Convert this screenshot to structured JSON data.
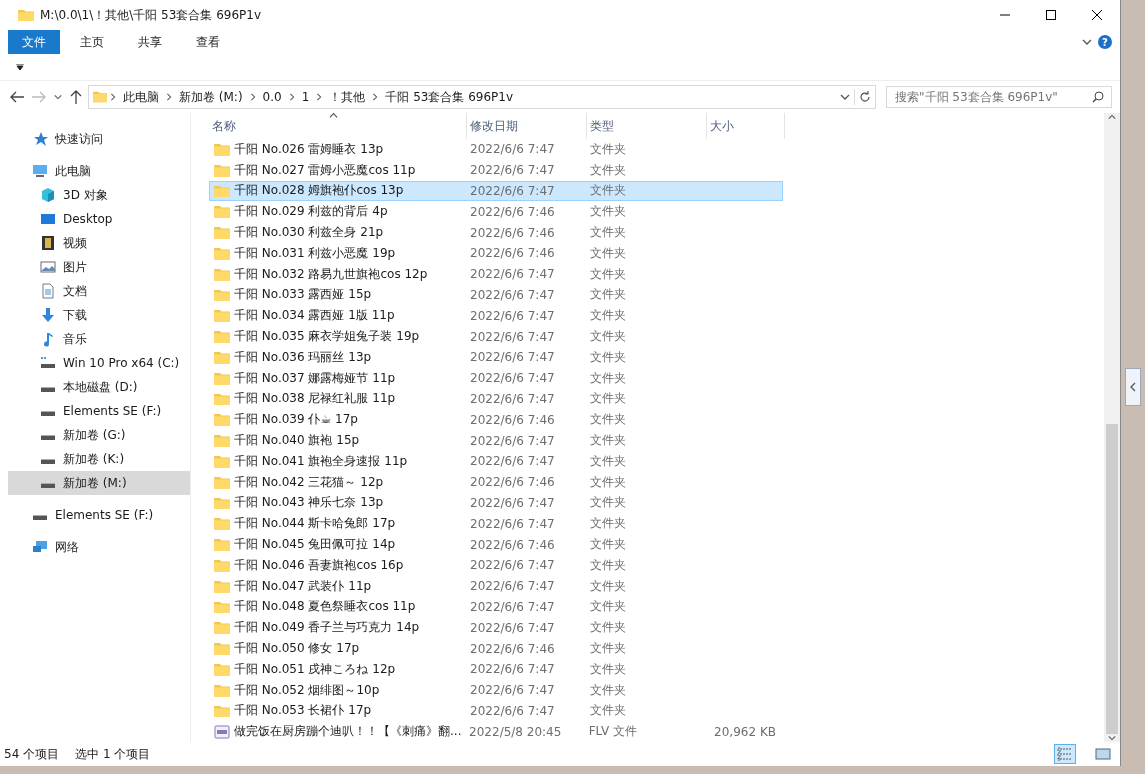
{
  "window": {
    "title": "M:\\0.0\\1\\！其他\\千阳 53套合集 696P1v"
  },
  "ribbon": {
    "tabs": [
      {
        "label": "文件",
        "selected": true
      },
      {
        "label": "主页",
        "selected": false
      },
      {
        "label": "共享",
        "selected": false
      },
      {
        "label": "查看",
        "selected": false
      }
    ],
    "help": "?"
  },
  "address_bar": {
    "path": [
      "此电脑",
      "新加卷 (M:)",
      "0.0",
      "1",
      "！其他",
      "千阳 53套合集 696P1v"
    ]
  },
  "search": {
    "placeholder": "搜索\"千阳 53套合集 696P1v\""
  },
  "sidebar": {
    "items": [
      {
        "label": "快速访问",
        "kind": "star",
        "selected": false
      },
      {
        "label": "此电脑",
        "kind": "pc",
        "selected": false,
        "children": [
          {
            "label": "3D 对象",
            "kind": "cube",
            "selected": false
          },
          {
            "label": "Desktop",
            "kind": "desktop",
            "selected": false
          },
          {
            "label": "视频",
            "kind": "film",
            "selected": false
          },
          {
            "label": "图片",
            "kind": "picture",
            "selected": false
          },
          {
            "label": "文档",
            "kind": "document",
            "selected": false
          },
          {
            "label": "下载",
            "kind": "download",
            "selected": false
          },
          {
            "label": "音乐",
            "kind": "music",
            "selected": false
          },
          {
            "label": "Win 10 Pro x64 (C:)",
            "kind": "system-drive",
            "selected": false
          },
          {
            "label": "本地磁盘 (D:)",
            "kind": "drive",
            "selected": false
          },
          {
            "label": "Elements SE (F:)",
            "kind": "drive",
            "selected": false
          },
          {
            "label": "新加卷 (G:)",
            "kind": "drive",
            "selected": false
          },
          {
            "label": "新加卷 (K:)",
            "kind": "drive",
            "selected": false
          },
          {
            "label": "新加卷 (M:)",
            "kind": "drive",
            "selected": true
          }
        ]
      },
      {
        "label": "Elements SE (F:)",
        "kind": "drive",
        "selected": false
      },
      {
        "label": "网络",
        "kind": "network",
        "selected": false
      }
    ]
  },
  "table": {
    "columns": [
      "名称",
      "修改日期",
      "类型",
      "大小"
    ],
    "rows": [
      {
        "kind": "folder",
        "name": "千阳 No.026 雷姆睡衣 13p",
        "date": "2022/6/6 7:47",
        "type": "文件夹",
        "selected": false
      },
      {
        "kind": "folder",
        "name": "千阳 No.027 雷姆小恶魔cos 11p",
        "date": "2022/6/6 7:47",
        "type": "文件夹",
        "selected": false
      },
      {
        "kind": "folder",
        "name": "千阳 No.028 姆旗袍仆cos 13p",
        "date": "2022/6/6 7:47",
        "type": "文件夹",
        "selected": true
      },
      {
        "kind": "folder",
        "name": "千阳 No.029 利兹的背后 4p",
        "date": "2022/6/6 7:46",
        "type": "文件夹",
        "selected": false
      },
      {
        "kind": "folder",
        "name": "千阳 No.030 利兹全身 21p",
        "date": "2022/6/6 7:46",
        "type": "文件夹",
        "selected": false
      },
      {
        "kind": "folder",
        "name": "千阳 No.031 利兹小恶魔 19p",
        "date": "2022/6/6 7:46",
        "type": "文件夹",
        "selected": false
      },
      {
        "kind": "folder",
        "name": "千阳 No.032 路易九世旗袍cos 12p",
        "date": "2022/6/6 7:47",
        "type": "文件夹",
        "selected": false
      },
      {
        "kind": "folder",
        "name": "千阳 No.033 露西娅 15p",
        "date": "2022/6/6 7:47",
        "type": "文件夹",
        "selected": false
      },
      {
        "kind": "folder",
        "name": "千阳 No.034 露西娅 1版 11p",
        "date": "2022/6/6 7:47",
        "type": "文件夹",
        "selected": false
      },
      {
        "kind": "folder",
        "name": "千阳 No.035 麻衣学姐兔子装 19p",
        "date": "2022/6/6 7:47",
        "type": "文件夹",
        "selected": false
      },
      {
        "kind": "folder",
        "name": "千阳 No.036 玛丽丝 13p",
        "date": "2022/6/6 7:47",
        "type": "文件夹",
        "selected": false
      },
      {
        "kind": "folder",
        "name": "千阳 No.037 娜露梅娅节 11p",
        "date": "2022/6/6 7:47",
        "type": "文件夹",
        "selected": false
      },
      {
        "kind": "folder",
        "name": "千阳 No.038 尼禄红礼服 11p",
        "date": "2022/6/6 7:47",
        "type": "文件夹",
        "selected": false
      },
      {
        "kind": "folder",
        "name": "千阳 No.039 仆☕ 17p",
        "date": "2022/6/6 7:46",
        "type": "文件夹",
        "selected": false
      },
      {
        "kind": "folder",
        "name": "千阳 No.040 旗袍 15p",
        "date": "2022/6/6 7:47",
        "type": "文件夹",
        "selected": false
      },
      {
        "kind": "folder",
        "name": "千阳 No.041 旗袍全身速报 11p",
        "date": "2022/6/6 7:47",
        "type": "文件夹",
        "selected": false
      },
      {
        "kind": "folder",
        "name": "千阳 No.042 三花猫～ 12p",
        "date": "2022/6/6 7:46",
        "type": "文件夹",
        "selected": false
      },
      {
        "kind": "folder",
        "name": "千阳 No.043 神乐七奈 13p",
        "date": "2022/6/6 7:47",
        "type": "文件夹",
        "selected": false
      },
      {
        "kind": "folder",
        "name": "千阳 No.044 斯卡哈兔郎 17p",
        "date": "2022/6/6 7:47",
        "type": "文件夹",
        "selected": false
      },
      {
        "kind": "folder",
        "name": "千阳 No.045 兔田佩可拉 14p",
        "date": "2022/6/6 7:46",
        "type": "文件夹",
        "selected": false
      },
      {
        "kind": "folder",
        "name": "千阳 No.046 吾妻旗袍cos 16p",
        "date": "2022/6/6 7:47",
        "type": "文件夹",
        "selected": false
      },
      {
        "kind": "folder",
        "name": "千阳 No.047 武装仆 11p",
        "date": "2022/6/6 7:47",
        "type": "文件夹",
        "selected": false
      },
      {
        "kind": "folder",
        "name": "千阳 No.048 夏色祭睡衣cos 11p",
        "date": "2022/6/6 7:47",
        "type": "文件夹",
        "selected": false
      },
      {
        "kind": "folder",
        "name": "千阳 No.049 香子兰与巧克力 14p",
        "date": "2022/6/6 7:47",
        "type": "文件夹",
        "selected": false
      },
      {
        "kind": "folder",
        "name": "千阳 No.050 修女 17p",
        "date": "2022/6/6 7:46",
        "type": "文件夹",
        "selected": false
      },
      {
        "kind": "folder",
        "name": "千阳 No.051 戌神ころね 12p",
        "date": "2022/6/6 7:47",
        "type": "文件夹",
        "selected": false
      },
      {
        "kind": "folder",
        "name": "千阳 No.052 烟绯图～10p",
        "date": "2022/6/6 7:47",
        "type": "文件夹",
        "selected": false
      },
      {
        "kind": "folder",
        "name": "千阳 No.053 长裙仆 17p",
        "date": "2022/6/6 7:47",
        "type": "文件夹",
        "selected": false
      },
      {
        "kind": "video",
        "name": "做完饭在厨房蹦个迪叭！！【《刺痛》翻...",
        "date": "2022/5/8 20:45",
        "type": "FLV 文件",
        "size": "20,962 KB",
        "selected": false
      }
    ]
  },
  "status_bar": {
    "count": "54 个项目",
    "selection": "选中 1 个项目"
  }
}
